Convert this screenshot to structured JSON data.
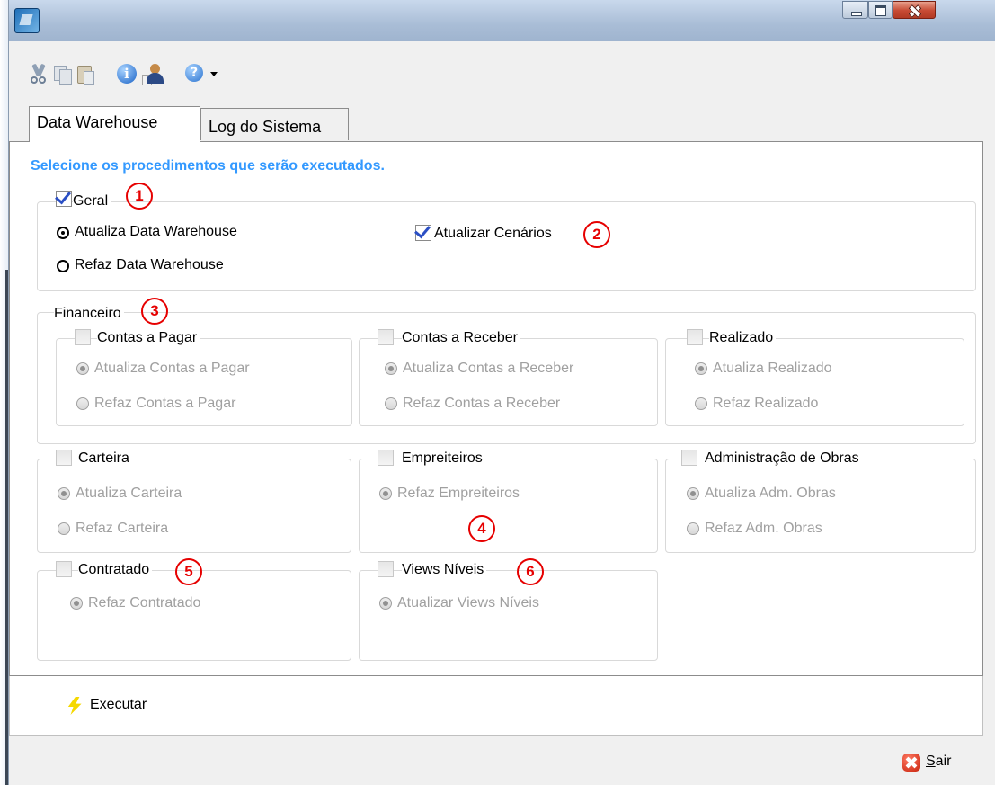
{
  "window": {
    "title": ""
  },
  "toolbar": {
    "icons": [
      "cut-icon",
      "copy-icon",
      "paste-icon",
      "info-icon",
      "user-icon",
      "help-icon",
      "chevron-down-icon"
    ]
  },
  "tabs": [
    {
      "label": "Data Warehouse",
      "active": true
    },
    {
      "label": "Log do Sistema",
      "active": false
    }
  ],
  "instruction": "Selecione os procedimentos que serão executados.",
  "geral": {
    "label": "Geral",
    "checked": true,
    "options": [
      "Atualiza Data Warehouse",
      "Refaz Data Warehouse"
    ],
    "selected": "Atualiza Data Warehouse",
    "atualizar_cenarios": {
      "label": "Atualizar Cenários",
      "checked": true
    }
  },
  "financeiro": {
    "label": "Financeiro",
    "contas_pagar": {
      "label": "Contas a Pagar",
      "checked": false,
      "options": [
        "Atualiza Contas a Pagar",
        "Refaz Contas a Pagar"
      ],
      "selected": "Atualiza Contas a Pagar"
    },
    "contas_receber": {
      "label": "Contas a Receber",
      "checked": false,
      "options": [
        "Atualiza Contas a Receber",
        "Refaz Contas a Receber"
      ],
      "selected": "Atualiza Contas a Receber"
    },
    "realizado": {
      "label": "Realizado",
      "checked": false,
      "options": [
        "Atualiza Realizado",
        "Refaz Realizado"
      ],
      "selected": "Atualiza Realizado"
    }
  },
  "carteira": {
    "label": "Carteira",
    "checked": false,
    "options": [
      "Atualiza Carteira",
      "Refaz Carteira"
    ],
    "selected": "Atualiza Carteira"
  },
  "empreiteiros": {
    "label": "Empreiteiros",
    "checked": false,
    "options": [
      "Refaz Empreiteiros"
    ],
    "selected": "Refaz Empreiteiros"
  },
  "adm_obras": {
    "label": "Administração de Obras",
    "checked": false,
    "options": [
      "Atualiza Adm. Obras",
      "Refaz Adm. Obras"
    ],
    "selected": "Atualiza Adm. Obras"
  },
  "contratado": {
    "label": "Contratado",
    "checked": false,
    "options": [
      "Refaz Contratado"
    ],
    "selected": "Refaz Contratado"
  },
  "views_niveis": {
    "label": "Views Níveis",
    "checked": false,
    "options": [
      "Atualizar Views Níveis"
    ],
    "selected": "Atualizar Views Níveis"
  },
  "markers": [
    "1",
    "2",
    "3",
    "4",
    "5",
    "6"
  ],
  "actions": {
    "executar": "Executar",
    "sair_first": "S",
    "sair_rest": "air"
  },
  "colors": {
    "instruction": "#3399ff",
    "marker": "#e60000",
    "disabled_text": "#a0a0a0"
  }
}
